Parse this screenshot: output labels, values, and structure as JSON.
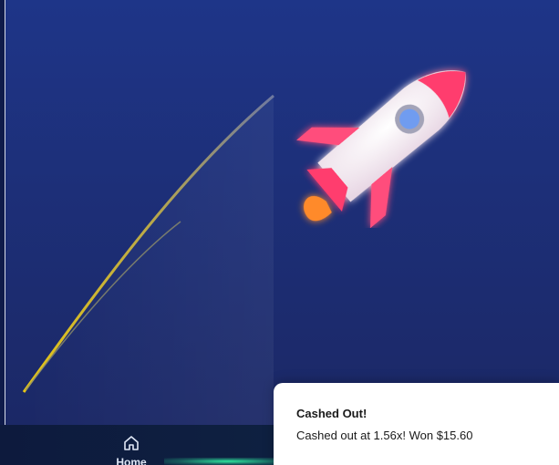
{
  "game": {
    "multiplier": 1.56,
    "colors": {
      "background_top": "#1e3588",
      "background_bottom": "#1b2866",
      "trail": "#d9c21c",
      "rocket_body": "#f1e7ef",
      "rocket_accent": "#ff3d6e",
      "rocket_window": "#6f9cf0",
      "flame": "#ff8a2b"
    },
    "rocket_icon": "rocket-icon"
  },
  "nav": {
    "home_label": "Home",
    "home_icon": "home-icon",
    "active_accent": "#2ee59d"
  },
  "toast": {
    "title": "Cashed Out!",
    "message": "Cashed out at 1.56x! Won $15.60"
  }
}
